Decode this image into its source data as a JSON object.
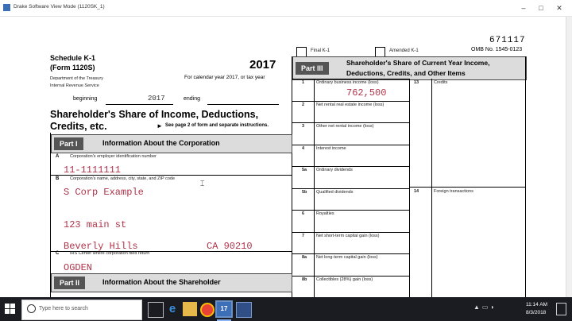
{
  "window": {
    "title": "Drake Software View Mode (1120SK_1)",
    "minimize": "–",
    "maximize": "□",
    "close": "✕"
  },
  "form": {
    "serial": "671117",
    "omb": "OMB No. 1545-0123",
    "final_k1": "Final K-1",
    "amended_k1": "Amended K-1",
    "schedule": "Schedule K-1",
    "form_name": "(Form 1120S)",
    "dept1": "Department of the Treasury",
    "dept2": "Internal Revenue Service",
    "year": "2017",
    "calendar": "For calendar year 2017, or tax year",
    "beginning": "beginning",
    "beginning_value": "2017",
    "ending": "ending",
    "share_title1": "Shareholder's Share of Income, Deductions,",
    "share_title2": "Credits, etc.",
    "see_page": "See page 2 of form and separate instructions."
  },
  "part1": {
    "label": "Part I",
    "title": "Information About the Corporation",
    "a_letter": "A",
    "a_label": "Corporation's employer identification number",
    "a_value": "11-1111111",
    "b_letter": "B",
    "b_label": "Corporation's name, address, city, state, and ZIP code",
    "b_name": "S Corp Example",
    "b_street": "123 main st",
    "b_city": "Beverly Hills",
    "b_state_zip": "CA 90210",
    "c_letter": "C",
    "c_label": "IRS Center where corporation filed return",
    "c_value": "OGDEN"
  },
  "part2": {
    "label": "Part II",
    "title": "Information About the Shareholder"
  },
  "part3": {
    "label": "Part III",
    "title1": "Shareholder's Share of Current Year Income,",
    "title2": "Deductions, Credits, and Other Items",
    "rows": [
      {
        "num": "1",
        "label": "Ordinary business income (loss)",
        "value": "762,500"
      },
      {
        "num": "2",
        "label": "Net rental real estate income (loss)",
        "value": ""
      },
      {
        "num": "3",
        "label": "Other net rental income (loss)",
        "value": ""
      },
      {
        "num": "4",
        "label": "Interest income",
        "value": ""
      },
      {
        "num": "5a",
        "label": "Ordinary dividends",
        "value": ""
      },
      {
        "num": "5b",
        "label": "Qualified dividends",
        "value": ""
      },
      {
        "num": "6",
        "label": "Royalties",
        "value": ""
      },
      {
        "num": "7",
        "label": "Net short-term capital gain (loss)",
        "value": ""
      },
      {
        "num": "8a",
        "label": "Net long-term capital gain (loss)",
        "value": ""
      },
      {
        "num": "8b",
        "label": "Collectibles (28%) gain (loss)",
        "value": ""
      }
    ],
    "right_rows": [
      {
        "num": "13",
        "label": "Credits"
      },
      {
        "num": "14",
        "label": "Foreign transactions"
      }
    ]
  },
  "taskbar": {
    "search_placeholder": "Type here to search",
    "time": "11:14 AM",
    "date": "8/3/2018",
    "active_app_label": "17"
  },
  "colors": {
    "entered_value": "#b0344a",
    "part_label_bg": "#555555",
    "part_bar_bg": "#dcdcdc",
    "taskbar_bg": "#1a1c21"
  }
}
